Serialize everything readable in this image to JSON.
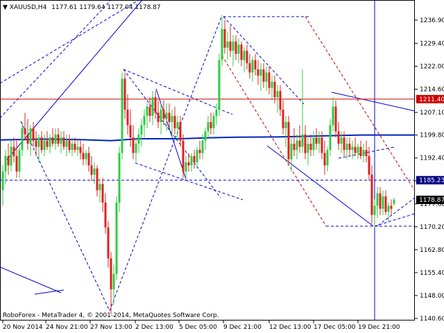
{
  "window": {
    "symbol": "XAUUSD,H4",
    "ohlc": "1177.61 1179.64 1177.04 1178.87",
    "copyright": "RoboForex - MetaTrader 4, © 2001-2014, MetaQuotes Software Corp."
  },
  "colors": {
    "bull": "#2ecc40",
    "bear": "#e02020",
    "trend": "#0000cc",
    "level_red": "#cc0000",
    "ma": "#0020c0",
    "current_price_bg": "#000000",
    "red_badge_bg": "#cc0000",
    "blue_badge_bg": "#000080"
  },
  "price_axis": {
    "labels": [
      "1236.90",
      "1229.40",
      "1222.00",
      "1214.60",
      "1207.10",
      "1199.80",
      "1192.40",
      "1185.00",
      "1177.60",
      "1170.20",
      "1162.80",
      "1155.40",
      "1148.00",
      "1140.60"
    ],
    "badges": {
      "red_level": "1211.40",
      "blue_level": "1185.23",
      "current": "1178.87"
    }
  },
  "time_axis": {
    "labels": [
      "20 Nov 2014",
      "24 Nov 21:00",
      "27 Nov 13:00",
      "2 Dec 13:00",
      "5 Dec 05:00",
      "9 Dec 21:00",
      "12 Dec 13:00",
      "17 Dec 05:00",
      "19 Dec 21:00"
    ]
  },
  "chart_data": {
    "type": "candlestick",
    "title": "XAUUSD,H4",
    "ylim": [
      1140.0,
      1239.0
    ],
    "levels": [
      1211.4,
      1185.23,
      1178.87
    ],
    "moving_average": [
      {
        "x": 0,
        "y": 1198.2
      },
      {
        "x": 60,
        "y": 1198.5
      },
      {
        "x": 120,
        "y": 1198.3
      },
      {
        "x": 160,
        "y": 1198.0
      },
      {
        "x": 200,
        "y": 1198.6
      },
      {
        "x": 260,
        "y": 1198.6
      },
      {
        "x": 300,
        "y": 1198.9
      },
      {
        "x": 340,
        "y": 1199.1
      },
      {
        "x": 400,
        "y": 1199.2
      },
      {
        "x": 440,
        "y": 1199.4
      },
      {
        "x": 480,
        "y": 1199.6
      },
      {
        "x": 520,
        "y": 1199.8
      },
      {
        "x": 598,
        "y": 1199.8
      }
    ],
    "candles": [
      {
        "x": 4,
        "o": 1182,
        "h": 1190,
        "l": 1177,
        "c": 1188
      },
      {
        "x": 8,
        "o": 1188,
        "h": 1195,
        "l": 1184,
        "c": 1193
      },
      {
        "x": 12,
        "o": 1193,
        "h": 1197,
        "l": 1187,
        "c": 1190
      },
      {
        "x": 16,
        "o": 1190,
        "h": 1198,
        "l": 1188,
        "c": 1196
      },
      {
        "x": 20,
        "o": 1196,
        "h": 1199,
        "l": 1191,
        "c": 1193
      },
      {
        "x": 24,
        "o": 1193,
        "h": 1198,
        "l": 1186,
        "c": 1188
      },
      {
        "x": 28,
        "o": 1188,
        "h": 1196,
        "l": 1186,
        "c": 1195
      },
      {
        "x": 32,
        "o": 1195,
        "h": 1204,
        "l": 1193,
        "c": 1202
      },
      {
        "x": 36,
        "o": 1202,
        "h": 1207,
        "l": 1198,
        "c": 1200
      },
      {
        "x": 40,
        "o": 1200,
        "h": 1205,
        "l": 1195,
        "c": 1197
      },
      {
        "x": 44,
        "o": 1197,
        "h": 1203,
        "l": 1193,
        "c": 1202
      },
      {
        "x": 48,
        "o": 1202,
        "h": 1204,
        "l": 1196,
        "c": 1198
      },
      {
        "x": 52,
        "o": 1198,
        "h": 1201,
        "l": 1193,
        "c": 1196
      },
      {
        "x": 56,
        "o": 1196,
        "h": 1200,
        "l": 1191,
        "c": 1199
      },
      {
        "x": 60,
        "o": 1199,
        "h": 1201,
        "l": 1194,
        "c": 1195
      },
      {
        "x": 64,
        "o": 1195,
        "h": 1200,
        "l": 1193,
        "c": 1198
      },
      {
        "x": 68,
        "o": 1198,
        "h": 1201,
        "l": 1195,
        "c": 1196
      },
      {
        "x": 72,
        "o": 1196,
        "h": 1200,
        "l": 1194,
        "c": 1199
      },
      {
        "x": 76,
        "o": 1199,
        "h": 1202,
        "l": 1196,
        "c": 1197
      },
      {
        "x": 80,
        "o": 1197,
        "h": 1202,
        "l": 1195,
        "c": 1200
      },
      {
        "x": 84,
        "o": 1200,
        "h": 1202,
        "l": 1196,
        "c": 1197
      },
      {
        "x": 88,
        "o": 1197,
        "h": 1201,
        "l": 1194,
        "c": 1199
      },
      {
        "x": 92,
        "o": 1199,
        "h": 1201,
        "l": 1195,
        "c": 1196
      },
      {
        "x": 96,
        "o": 1196,
        "h": 1200,
        "l": 1193,
        "c": 1198
      },
      {
        "x": 100,
        "o": 1198,
        "h": 1200,
        "l": 1194,
        "c": 1195
      },
      {
        "x": 104,
        "o": 1195,
        "h": 1199,
        "l": 1193,
        "c": 1197
      },
      {
        "x": 108,
        "o": 1197,
        "h": 1199,
        "l": 1194,
        "c": 1195
      },
      {
        "x": 112,
        "o": 1195,
        "h": 1198,
        "l": 1193,
        "c": 1196
      },
      {
        "x": 116,
        "o": 1196,
        "h": 1198,
        "l": 1192,
        "c": 1194
      },
      {
        "x": 120,
        "o": 1194,
        "h": 1197,
        "l": 1190,
        "c": 1192
      },
      {
        "x": 124,
        "o": 1192,
        "h": 1195,
        "l": 1190,
        "c": 1194
      },
      {
        "x": 128,
        "o": 1194,
        "h": 1196,
        "l": 1188,
        "c": 1190
      },
      {
        "x": 132,
        "o": 1190,
        "h": 1193,
        "l": 1185,
        "c": 1187
      },
      {
        "x": 136,
        "o": 1187,
        "h": 1191,
        "l": 1184,
        "c": 1189
      },
      {
        "x": 140,
        "o": 1189,
        "h": 1190,
        "l": 1180,
        "c": 1182
      },
      {
        "x": 144,
        "o": 1182,
        "h": 1186,
        "l": 1178,
        "c": 1184
      },
      {
        "x": 148,
        "o": 1184,
        "h": 1186,
        "l": 1175,
        "c": 1178
      },
      {
        "x": 152,
        "o": 1178,
        "h": 1181,
        "l": 1168,
        "c": 1170
      },
      {
        "x": 156,
        "o": 1170,
        "h": 1172,
        "l": 1157,
        "c": 1160
      },
      {
        "x": 160,
        "o": 1160,
        "h": 1162,
        "l": 1142,
        "c": 1150
      },
      {
        "x": 164,
        "o": 1150,
        "h": 1158,
        "l": 1145,
        "c": 1155
      },
      {
        "x": 168,
        "o": 1155,
        "h": 1180,
        "l": 1153,
        "c": 1178
      },
      {
        "x": 172,
        "o": 1178,
        "h": 1196,
        "l": 1175,
        "c": 1194
      },
      {
        "x": 176,
        "o": 1194,
        "h": 1220,
        "l": 1192,
        "c": 1218
      },
      {
        "x": 180,
        "o": 1218,
        "h": 1220,
        "l": 1205,
        "c": 1208
      },
      {
        "x": 184,
        "o": 1208,
        "h": 1213,
        "l": 1200,
        "c": 1203
      },
      {
        "x": 188,
        "o": 1203,
        "h": 1208,
        "l": 1196,
        "c": 1199
      },
      {
        "x": 192,
        "o": 1199,
        "h": 1203,
        "l": 1192,
        "c": 1194
      },
      {
        "x": 196,
        "o": 1194,
        "h": 1199,
        "l": 1191,
        "c": 1197
      },
      {
        "x": 200,
        "o": 1197,
        "h": 1202,
        "l": 1194,
        "c": 1200
      },
      {
        "x": 204,
        "o": 1200,
        "h": 1205,
        "l": 1196,
        "c": 1203
      },
      {
        "x": 208,
        "o": 1203,
        "h": 1208,
        "l": 1199,
        "c": 1206
      },
      {
        "x": 212,
        "o": 1206,
        "h": 1210,
        "l": 1202,
        "c": 1209
      },
      {
        "x": 216,
        "o": 1209,
        "h": 1212,
        "l": 1204,
        "c": 1206
      },
      {
        "x": 220,
        "o": 1206,
        "h": 1214,
        "l": 1203,
        "c": 1212
      },
      {
        "x": 224,
        "o": 1212,
        "h": 1214,
        "l": 1205,
        "c": 1207
      },
      {
        "x": 228,
        "o": 1207,
        "h": 1211,
        "l": 1202,
        "c": 1204
      },
      {
        "x": 232,
        "o": 1204,
        "h": 1210,
        "l": 1200,
        "c": 1208
      },
      {
        "x": 236,
        "o": 1208,
        "h": 1211,
        "l": 1203,
        "c": 1205
      },
      {
        "x": 240,
        "o": 1205,
        "h": 1210,
        "l": 1201,
        "c": 1207
      },
      {
        "x": 244,
        "o": 1207,
        "h": 1210,
        "l": 1202,
        "c": 1204
      },
      {
        "x": 248,
        "o": 1204,
        "h": 1208,
        "l": 1199,
        "c": 1206
      },
      {
        "x": 252,
        "o": 1206,
        "h": 1209,
        "l": 1200,
        "c": 1202
      },
      {
        "x": 256,
        "o": 1202,
        "h": 1206,
        "l": 1198,
        "c": 1204
      },
      {
        "x": 260,
        "o": 1204,
        "h": 1206,
        "l": 1196,
        "c": 1198
      },
      {
        "x": 264,
        "o": 1198,
        "h": 1200,
        "l": 1186,
        "c": 1188
      },
      {
        "x": 268,
        "o": 1188,
        "h": 1193,
        "l": 1186,
        "c": 1191
      },
      {
        "x": 272,
        "o": 1191,
        "h": 1194,
        "l": 1188,
        "c": 1190
      },
      {
        "x": 276,
        "o": 1190,
        "h": 1194,
        "l": 1188,
        "c": 1193
      },
      {
        "x": 280,
        "o": 1193,
        "h": 1195,
        "l": 1189,
        "c": 1191
      },
      {
        "x": 284,
        "o": 1191,
        "h": 1196,
        "l": 1189,
        "c": 1195
      },
      {
        "x": 288,
        "o": 1195,
        "h": 1198,
        "l": 1192,
        "c": 1194
      },
      {
        "x": 292,
        "o": 1194,
        "h": 1200,
        "l": 1192,
        "c": 1198
      },
      {
        "x": 296,
        "o": 1198,
        "h": 1202,
        "l": 1195,
        "c": 1201
      },
      {
        "x": 300,
        "o": 1201,
        "h": 1206,
        "l": 1199,
        "c": 1204
      },
      {
        "x": 304,
        "o": 1204,
        "h": 1207,
        "l": 1200,
        "c": 1202
      },
      {
        "x": 308,
        "o": 1202,
        "h": 1207,
        "l": 1200,
        "c": 1206
      },
      {
        "x": 312,
        "o": 1206,
        "h": 1210,
        "l": 1203,
        "c": 1208
      },
      {
        "x": 316,
        "o": 1208,
        "h": 1226,
        "l": 1206,
        "c": 1224
      },
      {
        "x": 320,
        "o": 1224,
        "h": 1238,
        "l": 1222,
        "c": 1234
      },
      {
        "x": 324,
        "o": 1234,
        "h": 1237,
        "l": 1226,
        "c": 1228
      },
      {
        "x": 328,
        "o": 1228,
        "h": 1233,
        "l": 1224,
        "c": 1230
      },
      {
        "x": 332,
        "o": 1230,
        "h": 1235,
        "l": 1225,
        "c": 1227
      },
      {
        "x": 336,
        "o": 1227,
        "h": 1232,
        "l": 1222,
        "c": 1230
      },
      {
        "x": 340,
        "o": 1230,
        "h": 1232,
        "l": 1224,
        "c": 1226
      },
      {
        "x": 344,
        "o": 1226,
        "h": 1231,
        "l": 1223,
        "c": 1229
      },
      {
        "x": 348,
        "o": 1229,
        "h": 1230,
        "l": 1222,
        "c": 1224
      },
      {
        "x": 352,
        "o": 1224,
        "h": 1228,
        "l": 1220,
        "c": 1227
      },
      {
        "x": 356,
        "o": 1227,
        "h": 1229,
        "l": 1221,
        "c": 1223
      },
      {
        "x": 360,
        "o": 1223,
        "h": 1226,
        "l": 1218,
        "c": 1220
      },
      {
        "x": 364,
        "o": 1220,
        "h": 1225,
        "l": 1217,
        "c": 1224
      },
      {
        "x": 368,
        "o": 1224,
        "h": 1226,
        "l": 1219,
        "c": 1221
      },
      {
        "x": 372,
        "o": 1221,
        "h": 1224,
        "l": 1216,
        "c": 1219
      },
      {
        "x": 376,
        "o": 1219,
        "h": 1223,
        "l": 1214,
        "c": 1221
      },
      {
        "x": 380,
        "o": 1221,
        "h": 1223,
        "l": 1215,
        "c": 1217
      },
      {
        "x": 384,
        "o": 1217,
        "h": 1222,
        "l": 1214,
        "c": 1220
      },
      {
        "x": 388,
        "o": 1220,
        "h": 1222,
        "l": 1213,
        "c": 1215
      },
      {
        "x": 392,
        "o": 1215,
        "h": 1219,
        "l": 1211,
        "c": 1217
      },
      {
        "x": 396,
        "o": 1217,
        "h": 1219,
        "l": 1210,
        "c": 1212
      },
      {
        "x": 400,
        "o": 1212,
        "h": 1216,
        "l": 1207,
        "c": 1214
      },
      {
        "x": 404,
        "o": 1214,
        "h": 1216,
        "l": 1206,
        "c": 1208
      },
      {
        "x": 408,
        "o": 1208,
        "h": 1211,
        "l": 1200,
        "c": 1202
      },
      {
        "x": 412,
        "o": 1202,
        "h": 1206,
        "l": 1196,
        "c": 1204
      },
      {
        "x": 416,
        "o": 1204,
        "h": 1206,
        "l": 1190,
        "c": 1192
      },
      {
        "x": 420,
        "o": 1192,
        "h": 1199,
        "l": 1188,
        "c": 1197
      },
      {
        "x": 424,
        "o": 1197,
        "h": 1202,
        "l": 1193,
        "c": 1195
      },
      {
        "x": 428,
        "o": 1195,
        "h": 1200,
        "l": 1192,
        "c": 1198
      },
      {
        "x": 432,
        "o": 1198,
        "h": 1203,
        "l": 1194,
        "c": 1196
      },
      {
        "x": 436,
        "o": 1196,
        "h": 1221,
        "l": 1194,
        "c": 1200
      },
      {
        "x": 440,
        "o": 1200,
        "h": 1203,
        "l": 1192,
        "c": 1194
      },
      {
        "x": 444,
        "o": 1194,
        "h": 1199,
        "l": 1190,
        "c": 1197
      },
      {
        "x": 448,
        "o": 1197,
        "h": 1200,
        "l": 1193,
        "c": 1195
      },
      {
        "x": 452,
        "o": 1195,
        "h": 1201,
        "l": 1193,
        "c": 1199
      },
      {
        "x": 456,
        "o": 1199,
        "h": 1202,
        "l": 1195,
        "c": 1197
      },
      {
        "x": 460,
        "o": 1197,
        "h": 1201,
        "l": 1194,
        "c": 1199
      },
      {
        "x": 464,
        "o": 1199,
        "h": 1201,
        "l": 1192,
        "c": 1194
      },
      {
        "x": 468,
        "o": 1194,
        "h": 1198,
        "l": 1187,
        "c": 1190
      },
      {
        "x": 472,
        "o": 1190,
        "h": 1196,
        "l": 1188,
        "c": 1195
      },
      {
        "x": 476,
        "o": 1195,
        "h": 1205,
        "l": 1193,
        "c": 1203
      },
      {
        "x": 480,
        "o": 1203,
        "h": 1212,
        "l": 1201,
        "c": 1209
      },
      {
        "x": 484,
        "o": 1209,
        "h": 1211,
        "l": 1199,
        "c": 1201
      },
      {
        "x": 488,
        "o": 1201,
        "h": 1204,
        "l": 1195,
        "c": 1197
      },
      {
        "x": 492,
        "o": 1197,
        "h": 1201,
        "l": 1194,
        "c": 1199
      },
      {
        "x": 496,
        "o": 1199,
        "h": 1201,
        "l": 1193,
        "c": 1195
      },
      {
        "x": 500,
        "o": 1195,
        "h": 1199,
        "l": 1192,
        "c": 1197
      },
      {
        "x": 504,
        "o": 1197,
        "h": 1199,
        "l": 1193,
        "c": 1195
      },
      {
        "x": 508,
        "o": 1195,
        "h": 1198,
        "l": 1192,
        "c": 1196
      },
      {
        "x": 512,
        "o": 1196,
        "h": 1199,
        "l": 1193,
        "c": 1194
      },
      {
        "x": 516,
        "o": 1194,
        "h": 1197,
        "l": 1192,
        "c": 1196
      },
      {
        "x": 520,
        "o": 1196,
        "h": 1198,
        "l": 1192,
        "c": 1193
      },
      {
        "x": 524,
        "o": 1193,
        "h": 1197,
        "l": 1191,
        "c": 1195
      },
      {
        "x": 528,
        "o": 1195,
        "h": 1198,
        "l": 1191,
        "c": 1193
      },
      {
        "x": 532,
        "o": 1193,
        "h": 1196,
        "l": 1185,
        "c": 1187
      },
      {
        "x": 536,
        "o": 1187,
        "h": 1190,
        "l": 1171,
        "c": 1174
      },
      {
        "x": 540,
        "o": 1174,
        "h": 1179,
        "l": 1170,
        "c": 1177
      },
      {
        "x": 544,
        "o": 1177,
        "h": 1183,
        "l": 1173,
        "c": 1181
      },
      {
        "x": 548,
        "o": 1181,
        "h": 1183,
        "l": 1174,
        "c": 1176
      },
      {
        "x": 552,
        "o": 1176,
        "h": 1182,
        "l": 1174,
        "c": 1180
      },
      {
        "x": 556,
        "o": 1180,
        "h": 1182,
        "l": 1174,
        "c": 1175
      },
      {
        "x": 560,
        "o": 1175,
        "h": 1178,
        "l": 1172,
        "c": 1177
      },
      {
        "x": 564,
        "o": 1177,
        "h": 1179,
        "l": 1174,
        "c": 1176
      },
      {
        "x": 568,
        "o": 1177.6,
        "h": 1179.6,
        "l": 1177.0,
        "c": 1178.9
      }
    ]
  }
}
